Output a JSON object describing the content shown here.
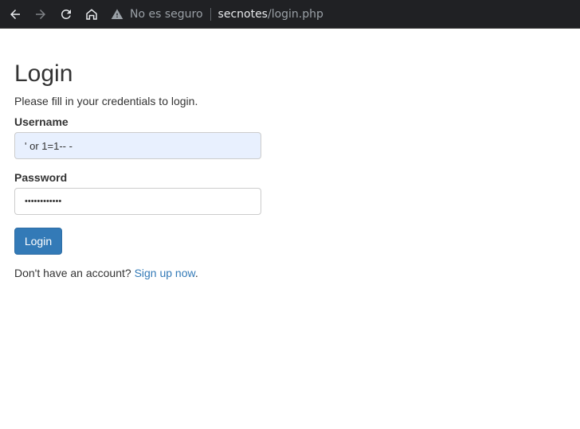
{
  "browser": {
    "security_label": "No es seguro",
    "url_host": "secnotes",
    "url_path": "/login.php"
  },
  "page": {
    "title": "Login",
    "subtitle": "Please fill in your credentials to login.",
    "username_label": "Username",
    "username_value": "' or 1=1-- -",
    "password_label": "Password",
    "password_value": "••••••••••••",
    "login_button": "Login",
    "signup_prompt": "Don't have an account?",
    "signup_link": "Sign up now",
    "signup_period": "."
  },
  "colors": {
    "toolbar_bg": "#202124",
    "button_primary": "#337ab7",
    "link": "#337ab7",
    "autofill_bg": "#e8f0fe"
  },
  "icons": [
    "back-arrow-icon",
    "forward-arrow-icon",
    "reload-icon",
    "home-icon",
    "warning-icon"
  ]
}
